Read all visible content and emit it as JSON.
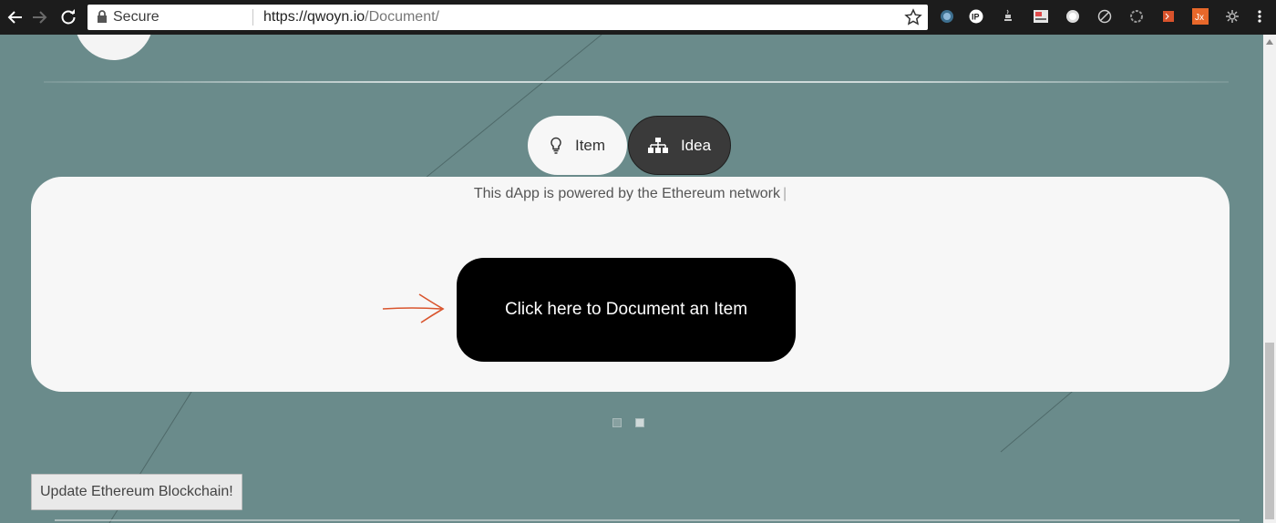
{
  "browser": {
    "secure_label": "Secure",
    "url_host": "https://qwoyn.io",
    "url_path": "/Document/",
    "extensions": [
      {
        "name": "shield-ext-icon",
        "color": "#8fb8d8"
      },
      {
        "name": "ip-ext-icon",
        "text": "IP",
        "color": "#ffffff"
      },
      {
        "name": "java-ext-icon",
        "color": "#c8c8c8"
      },
      {
        "name": "screenshot-ext-icon",
        "color": "#e04a4a"
      },
      {
        "name": "circle-ext-icon",
        "color": "#dddddd"
      },
      {
        "name": "compass-ext-icon",
        "color": "#cccccc"
      },
      {
        "name": "gear-ext-icon",
        "color": "#999999"
      },
      {
        "name": "puzzle-ext-icon",
        "color": "#d9532c"
      },
      {
        "name": "jx-ext-icon",
        "text": "Jx",
        "color": "#e8682a"
      },
      {
        "name": "settings-ext-icon",
        "color": "#bbbbbb"
      }
    ]
  },
  "tabs": {
    "item_label": "Item",
    "idea_label": "Idea"
  },
  "card": {
    "powered_text": "This dApp is powered by the Ethereum network",
    "cursor_char": "|",
    "cta_label": "Click here to Document an Item"
  },
  "footer": {
    "update_label": "Update Ethereum Blockchain!"
  },
  "colors": {
    "page_background": "#6a8b8b",
    "card_background": "#f7f7f7",
    "cta_background": "#000000",
    "arrow_color": "#d9552e"
  }
}
